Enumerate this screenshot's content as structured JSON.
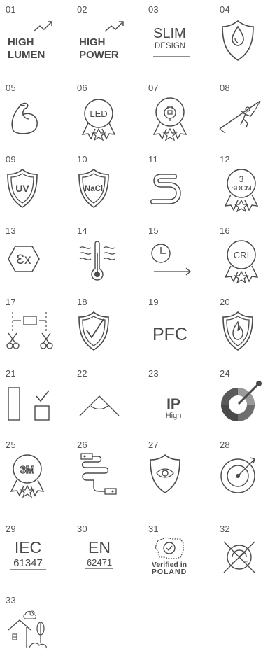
{
  "numbers": [
    "01",
    "02",
    "03",
    "04",
    "05",
    "06",
    "07",
    "08",
    "09",
    "10",
    "11",
    "12",
    "13",
    "14",
    "15",
    "16",
    "17",
    "18",
    "19",
    "20",
    "21",
    "22",
    "23",
    "24",
    "25",
    "26",
    "27",
    "28",
    "29",
    "30",
    "31",
    "32",
    "33"
  ],
  "icon_names": [
    "high-lumen-icon",
    "high-power-icon",
    "slim-design-icon",
    "water-drop-shield-icon",
    "strong-arm-icon",
    "led-badge-icon",
    "plug-badge-icon",
    "climber-icon",
    "uv-shield-icon",
    "nacl-shield-icon",
    "flexible-cable-icon",
    "sdcm-badge-icon",
    "ex-hexagon-icon",
    "thermometer-icon",
    "timer-arrow-icon",
    "cri-badge-icon",
    "cut-scissors-icon",
    "check-shield-icon",
    "pfc-icon",
    "fire-shield-icon",
    "size-check-icon",
    "beam-angle-icon",
    "ip-high-icon",
    "color-wheel-icon",
    "3m-badge-icon",
    "cable-connector-icon",
    "eye-shield-icon",
    "target-icon",
    "iec-icon",
    "en-icon",
    "verified-poland-icon",
    "no-dimming-icon",
    "outdoor-home-icon"
  ],
  "labels": {
    "high_lumen_1": "HIGH",
    "high_lumen_2": "LUMEN",
    "high_power_1": "HIGH",
    "high_power_2": "POWER",
    "slim_1": "SLIM",
    "slim_2": "DESIGN",
    "led": "LED",
    "uv": "UV",
    "nacl": "NaCl",
    "sdcm_1": "3",
    "sdcm_2": "SDCM",
    "ex": "Ɛx",
    "cri": "CRI",
    "pfc": "PFC",
    "ip_1": "IP",
    "ip_2": "High",
    "m3": "3M",
    "iec_1": "IEC",
    "iec_2": "61347",
    "en_1": "EN",
    "en_2": "62471",
    "verified_1": "Verified in",
    "verified_2": "POLAND",
    "minus": "-",
    "plus": "+"
  }
}
